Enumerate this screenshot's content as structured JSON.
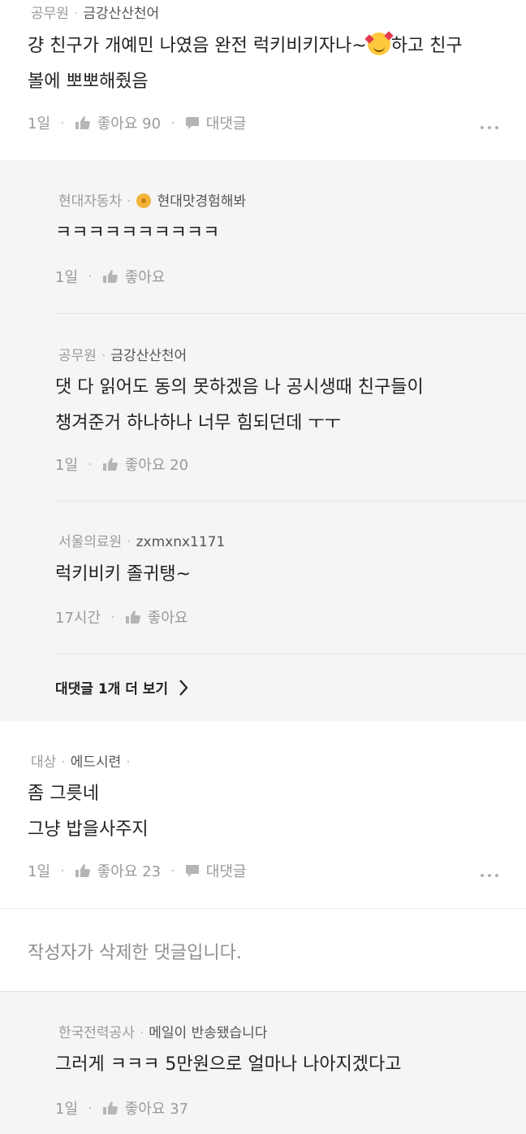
{
  "comments": [
    {
      "company": "공무원",
      "nickname": "금강산산천어",
      "text_line1_a": "걍 친구가 개예민 나였음 완전 럭키비키자나~",
      "text_line1_b": "하고 친구",
      "text_line2": "볼에 뽀뽀해줬음",
      "time": "1일",
      "like_label": "좋아요 90",
      "reply_label": "대댓글"
    },
    {
      "company": "대상",
      "nickname": "에드시련",
      "nick_suffix": "·",
      "text_line1": "좀 그릇네",
      "text_line2": "그냥 밥을사주지",
      "time": "1일",
      "like_label": "좋아요 23",
      "reply_label": "대댓글"
    }
  ],
  "replies_block1": [
    {
      "company": "현대자동차",
      "nickname": "현대맛경험해봐",
      "text": "ㅋㅋㅋㅋㅋㅋㅋㅋㅋㅋ",
      "time": "1일",
      "like_label": "좋아요"
    },
    {
      "company": "공무원",
      "nickname": "금강산산천어",
      "text_line1": "댓 다 읽어도 동의 못하겠음 나 공시생때 친구들이",
      "text_line2": "챙겨준거 하나하나 너무 힘되던데 ㅜㅜ",
      "time": "1일",
      "like_label": "좋아요 20"
    },
    {
      "company": "서울의료원",
      "nickname": "zxmxnx1171",
      "text": "럭키비키 졸귀탱~",
      "time": "17시간",
      "like_label": "좋아요"
    }
  ],
  "see_more_label": "대댓글 1개 더 보기",
  "deleted_text": "작성자가 삭제한 댓글입니다.",
  "replies_block2": [
    {
      "company": "한국전력공사",
      "nickname": "메일이 반송됐습니다",
      "text": "그러게 ㅋㅋㅋ 5만원으로 얼마나 나아지겠다고",
      "time": "1일",
      "like_label": "좋아요 37"
    }
  ],
  "icons": {
    "like": "thumbs-up-icon",
    "reply": "speech-bubble-icon",
    "more": "more-dots-icon",
    "chevron": "chevron-right-icon",
    "badge": "sunflower-badge-icon",
    "emoji": "smiling-face-with-hearts-icon"
  }
}
